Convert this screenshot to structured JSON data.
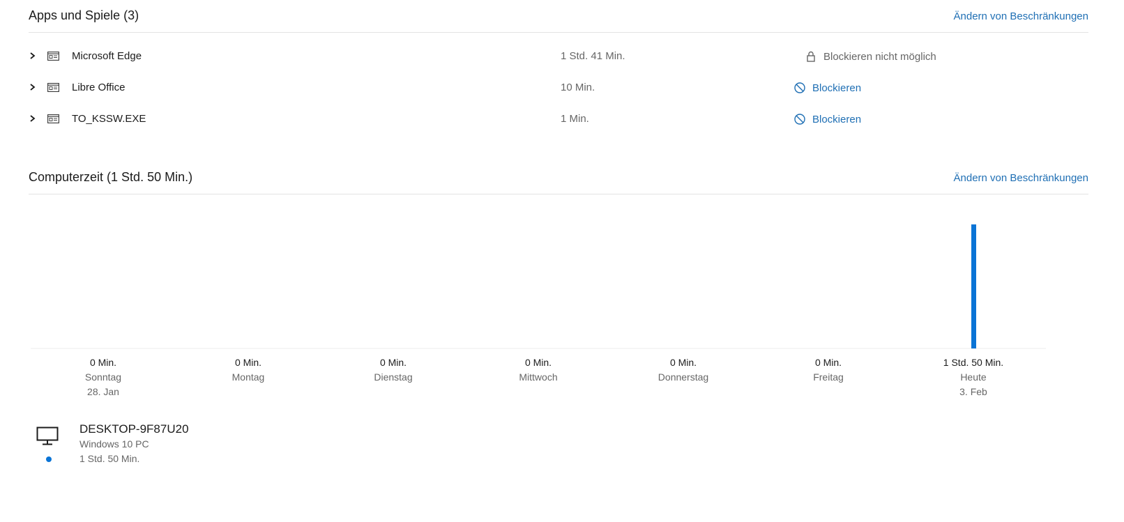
{
  "apps_section": {
    "title": "Apps und Spiele (3)",
    "change_link": "Ändern von Beschränkungen",
    "apps": [
      {
        "name": "Microsoft Edge",
        "time": "1 Std. 41 Min.",
        "action": "Blockieren nicht möglich",
        "action_type": "locked",
        "icon": "app-window-icon"
      },
      {
        "name": "Libre Office",
        "time": "10 Min.",
        "action": "Blockieren",
        "action_type": "block",
        "icon": "app-window-icon"
      },
      {
        "name": "TO_KSSW.EXE",
        "time": "1 Min.",
        "action": "Blockieren",
        "action_type": "block",
        "icon": "app-window-icon"
      }
    ]
  },
  "screen_time_section": {
    "title": "Computerzeit (1 Std. 50 Min.)",
    "change_link": "Ändern von Beschränkungen"
  },
  "chart_data": {
    "type": "bar",
    "categories": [
      "Sonntag",
      "Montag",
      "Dienstag",
      "Mittwoch",
      "Donnerstag",
      "Freitag",
      "Heute"
    ],
    "dates": [
      "28. Jan",
      "",
      "",
      "",
      "",
      "",
      "3. Feb"
    ],
    "value_labels": [
      "0 Min.",
      "0 Min.",
      "0 Min.",
      "0 Min.",
      "0 Min.",
      "0 Min.",
      "1 Std. 50 Min."
    ],
    "values": [
      0,
      0,
      0,
      0,
      0,
      0,
      110
    ],
    "ylim": [
      0,
      110
    ],
    "bar_color": "#0a74d6",
    "grid": false
  },
  "device": {
    "name": "DESKTOP-9F87U20",
    "type": "Windows 10 PC",
    "time": "1 Std. 50 Min.",
    "icon": "monitor-icon",
    "dot_color": "#0a74d6"
  }
}
